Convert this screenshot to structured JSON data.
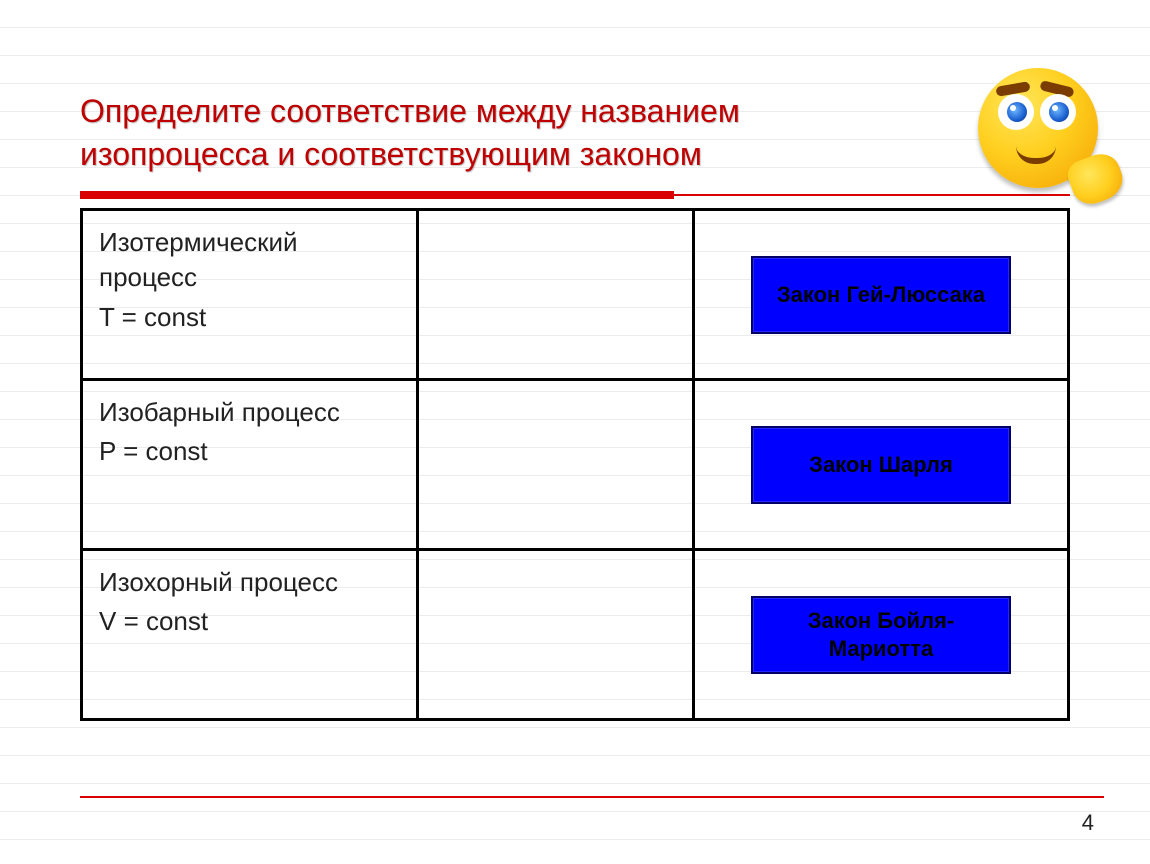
{
  "title": "Определите соответствие между названием изопроцесса и соответствующим законом",
  "rows": [
    {
      "process": "Изотермический процесс",
      "formula": "T = const",
      "law": "Закон Гей-Люссака"
    },
    {
      "process": "Изобарный процесс",
      "formula": "P = const",
      "law": "Закон Шарля"
    },
    {
      "process": "Изохорный процесс",
      "formula": "V = const",
      "law": "Закон Бойля-Мариотта"
    }
  ],
  "page_number": "4"
}
